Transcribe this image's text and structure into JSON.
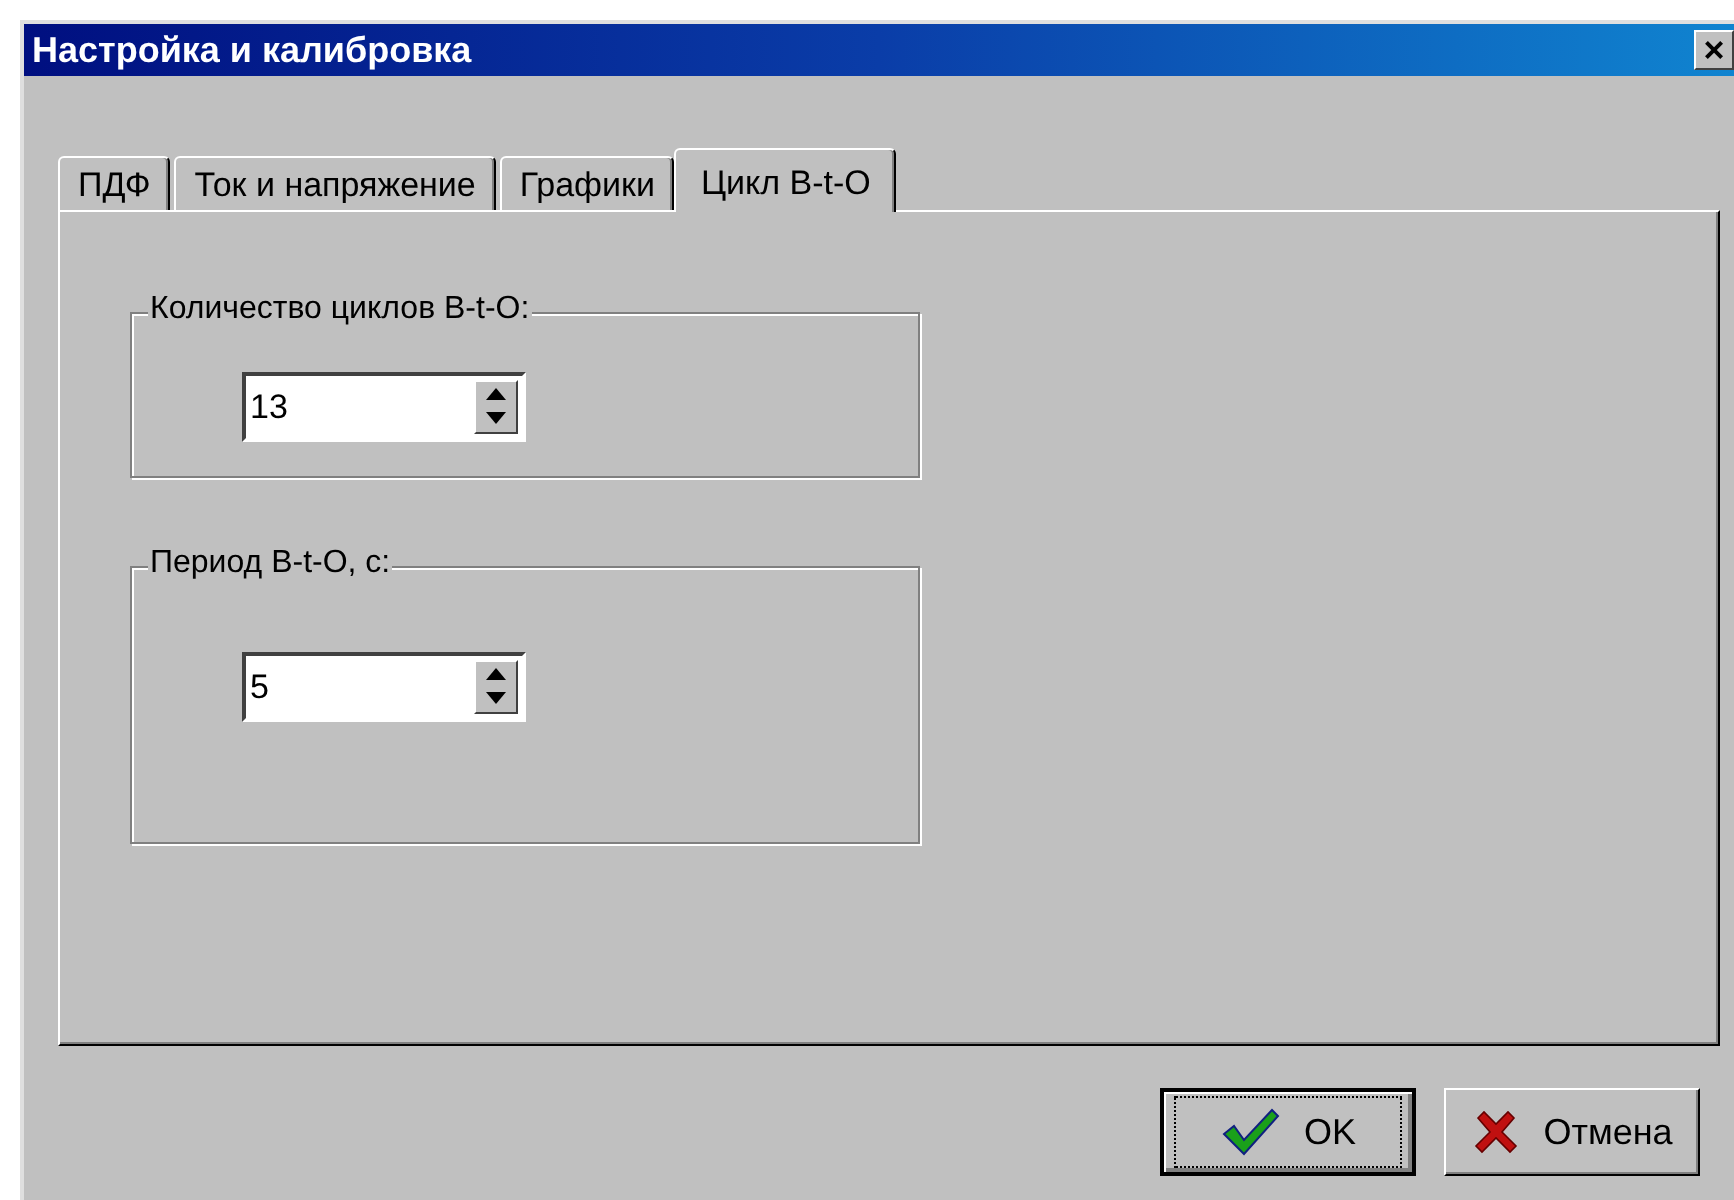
{
  "window": {
    "title": "Настройка и калибровка",
    "close": "×"
  },
  "tabs": [
    {
      "label": "ПДФ",
      "selected": false
    },
    {
      "label": "Ток и напряжение",
      "selected": false
    },
    {
      "label": "Графики",
      "selected": false
    },
    {
      "label": "Цикл В-t-О",
      "selected": true
    }
  ],
  "groups": [
    {
      "label": "Количество циклов В-t-О:",
      "value": "13"
    },
    {
      "label": "Период В-t-О, с:",
      "value": "5"
    }
  ],
  "buttons": [
    {
      "label": "OK",
      "kind": "ok",
      "focused": true
    },
    {
      "label": "Отмена",
      "kind": "cancel",
      "focused": false
    }
  ]
}
